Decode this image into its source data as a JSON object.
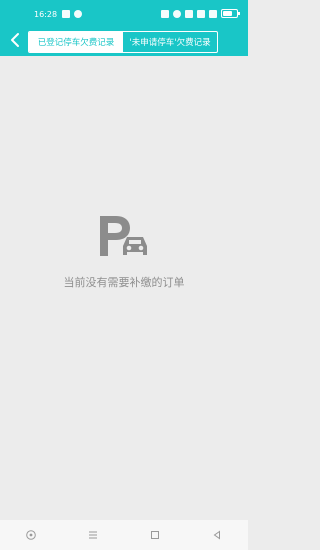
{
  "status_bar": {
    "time": "16:28",
    "icons": [
      "telegram-icon",
      "q-icon",
      "nfc-icon",
      "location-icon",
      "hd-icon",
      "wifi-icon",
      "signal-icon",
      "battery-icon"
    ]
  },
  "header": {
    "back_icon": "chevron-left-icon",
    "tabs": [
      {
        "label": "已登记停车欠费记录"
      },
      {
        "label": "'未申请停车'欠费记录"
      }
    ],
    "accent_color": "#19c6c7"
  },
  "empty_state": {
    "icon": "parking-car-icon",
    "message": "当前没有需要补缴的订单"
  },
  "nav_bar": {
    "icons": [
      "circle-home-icon",
      "menu-icon",
      "square-icon",
      "back-triangle-icon"
    ]
  }
}
